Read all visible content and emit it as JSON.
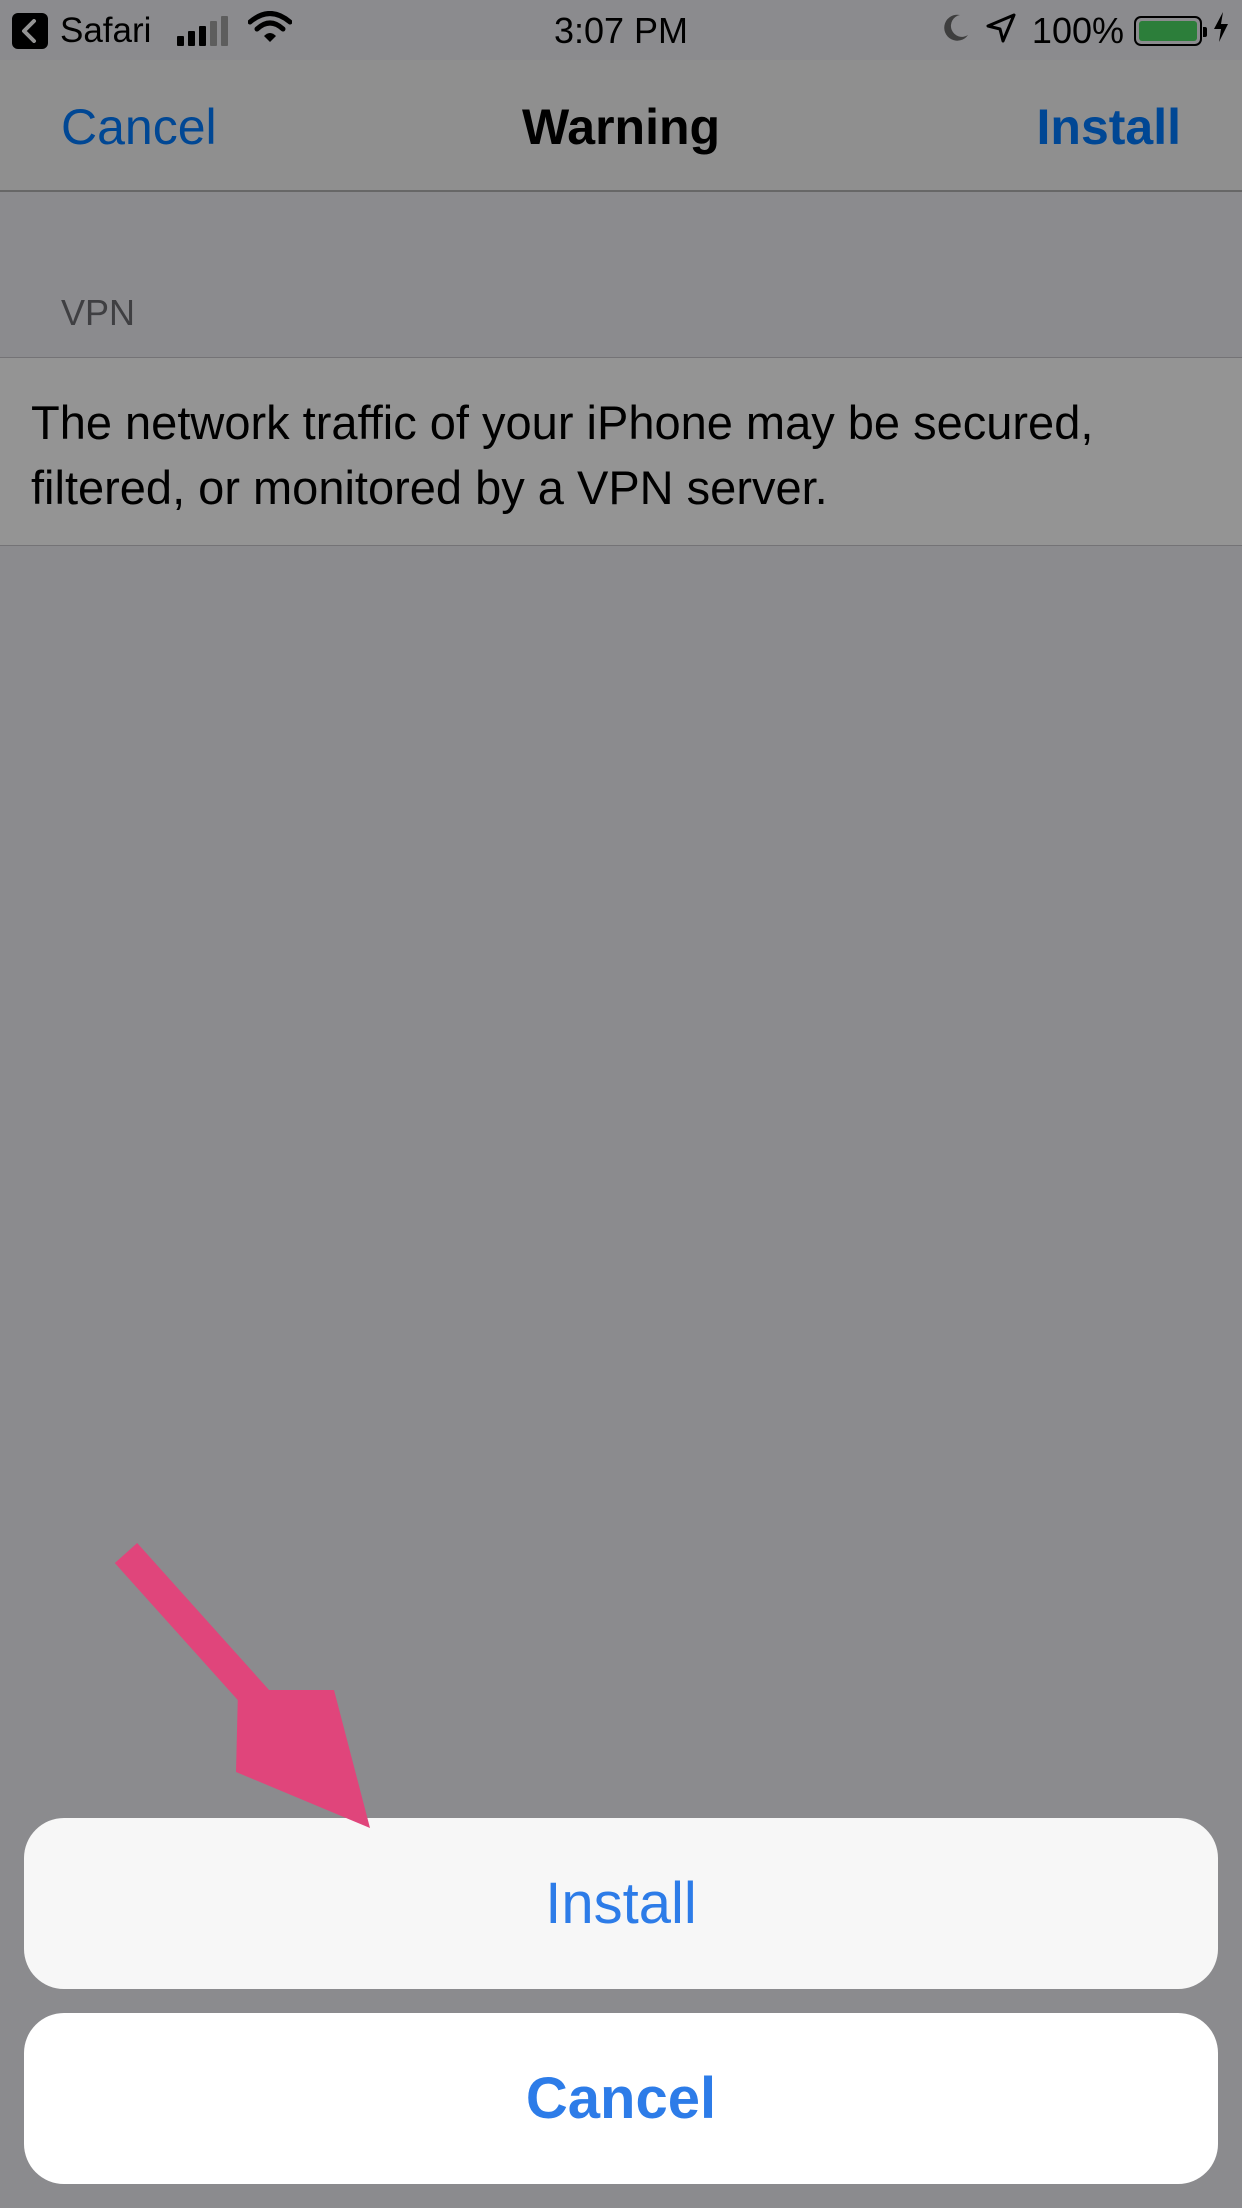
{
  "status_bar": {
    "back_app": "Safari",
    "time": "3:07 PM",
    "battery_percent": "100%",
    "battery_level": 1.0,
    "icons": [
      "back-icon",
      "signal-icon",
      "wifi-icon",
      "moon-icon",
      "location-icon",
      "battery-icon",
      "charging-icon"
    ]
  },
  "nav": {
    "cancel_label": "Cancel",
    "title": "Warning",
    "install_label": "Install"
  },
  "section": {
    "header": "VPN",
    "body": "The network traffic of your iPhone may be secured, filtered, or monitored by a VPN server."
  },
  "action_sheet": {
    "install_label": "Install",
    "cancel_label": "Cancel"
  },
  "colors": {
    "accent": "#007aff",
    "sheet_text": "#2d7ce8",
    "arrow": "#e0457b",
    "battery": "#4cd964"
  }
}
